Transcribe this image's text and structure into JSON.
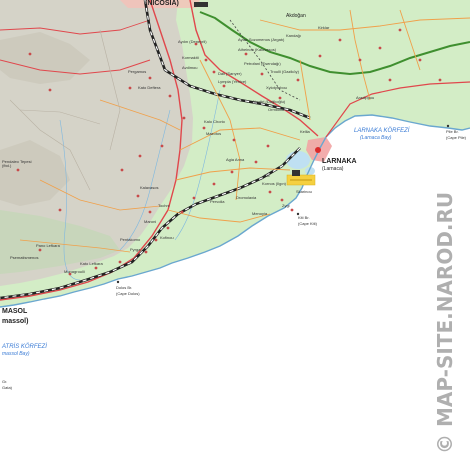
{
  "map": {
    "capital": "(NICOSIA)",
    "city_east": "Akdoğan",
    "larnaca": "LARNAKA",
    "larnaca_alt": "(Larnaca)",
    "limassol_a": "MASOL",
    "limassol_b": "massol)",
    "bay_larnaca_a": "LARNAKA KÖRFEZİ",
    "bay_larnaca_b": "(Larnaca Bay)",
    "bay_akrotiri_a": "ATRİS KÖRFEZİ",
    "bay_akrotiri_b": "massol Bay)",
    "cape_pyla_a": "Pile Br.",
    "cape_pyla_b": "(Cape Pile)",
    "cape_kiti_a": "Kiti Br.",
    "cape_kiti_b": "(Cape Kiti)",
    "cape_dolos_a": "Dolos Br.",
    "cape_dolos_b": "(Cape Dolos)",
    "cape_gata_a": "Gr.",
    "cape_gata_b": "Gata)",
    "pentadaktylos": "Pendaleo Tepesi\n(fbd.)",
    "small_labels": [
      "Aydın (Deneyrli)",
      "Ayios Sozomenos (Argatı)",
      "Kandağı",
      "Kirklar",
      "Atheinou (Kalovasos)",
      "Petrofani (Esendağı)",
      "Kormakiti",
      "Avdimou",
      "Pergamos",
      "Troulli (Gaziköy)",
      "Dali (Sarıyer)",
      "Lympia (Yenice)",
      "Kato Deftera",
      "Xylotymbou",
      "Akrotiri (Dağlıoğlu)",
      "Ormidhia",
      "Aradippou",
      "Kalo Chorio",
      "Mazotos",
      "Kellia",
      "Agia Anna",
      "Kiti",
      "Kornos (Ilgın)",
      "Dromolaxia",
      "Pervolia",
      "Menoyia",
      "Zygi",
      "Tochni",
      "Kalavasos",
      "Maroni",
      "Pentakomo",
      "Pyrga",
      "Kato Lefkara",
      "Kofinou",
      "Monagroulli",
      "Pano Lefkara",
      "Psematismenos",
      "Skarinou"
    ],
    "watermark": "© MAP-SITE.NAROD.RU"
  }
}
